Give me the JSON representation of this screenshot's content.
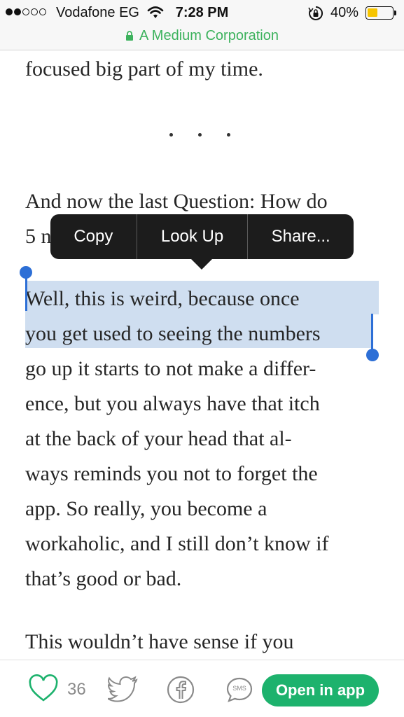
{
  "status_bar": {
    "carrier": "Vodafone EG",
    "time": "7:28 PM",
    "battery_percent_label": "40%",
    "battery_level": 0.4,
    "signal_bars_filled": 2,
    "signal_bars_total": 5
  },
  "url_bar": {
    "site": "A Medium Corporation",
    "lock_icon": "lock-icon"
  },
  "article": {
    "line_top": "focused big part of my time.",
    "q_line1": "And now the last Question: How do",
    "q_line2": "5 n",
    "p_lines": [
      "Well, this is weird, because once",
      "you get used to seeing the numbers",
      "go up it starts to not make a differ-",
      "ence, but you always have that itch",
      "at the back of your head that al-",
      "ways reminds you not to forget the",
      "app. So really, you become a",
      "workaholic, and I still don’t know if",
      "that’s good or bad."
    ],
    "last_line": "This wouldn’t have sense if you"
  },
  "context_menu": {
    "copy": "Copy",
    "look_up": "Look Up",
    "share": "Share..."
  },
  "bottom_bar": {
    "like_count": "36",
    "sms_label": "SMS",
    "open_in_app": "Open in app",
    "accent": "#1db26d"
  },
  "colors": {
    "selection": "#cfdef0",
    "handle": "#2d6fd6",
    "url_green": "#3db25d",
    "battery_fill": "#f7c500"
  }
}
